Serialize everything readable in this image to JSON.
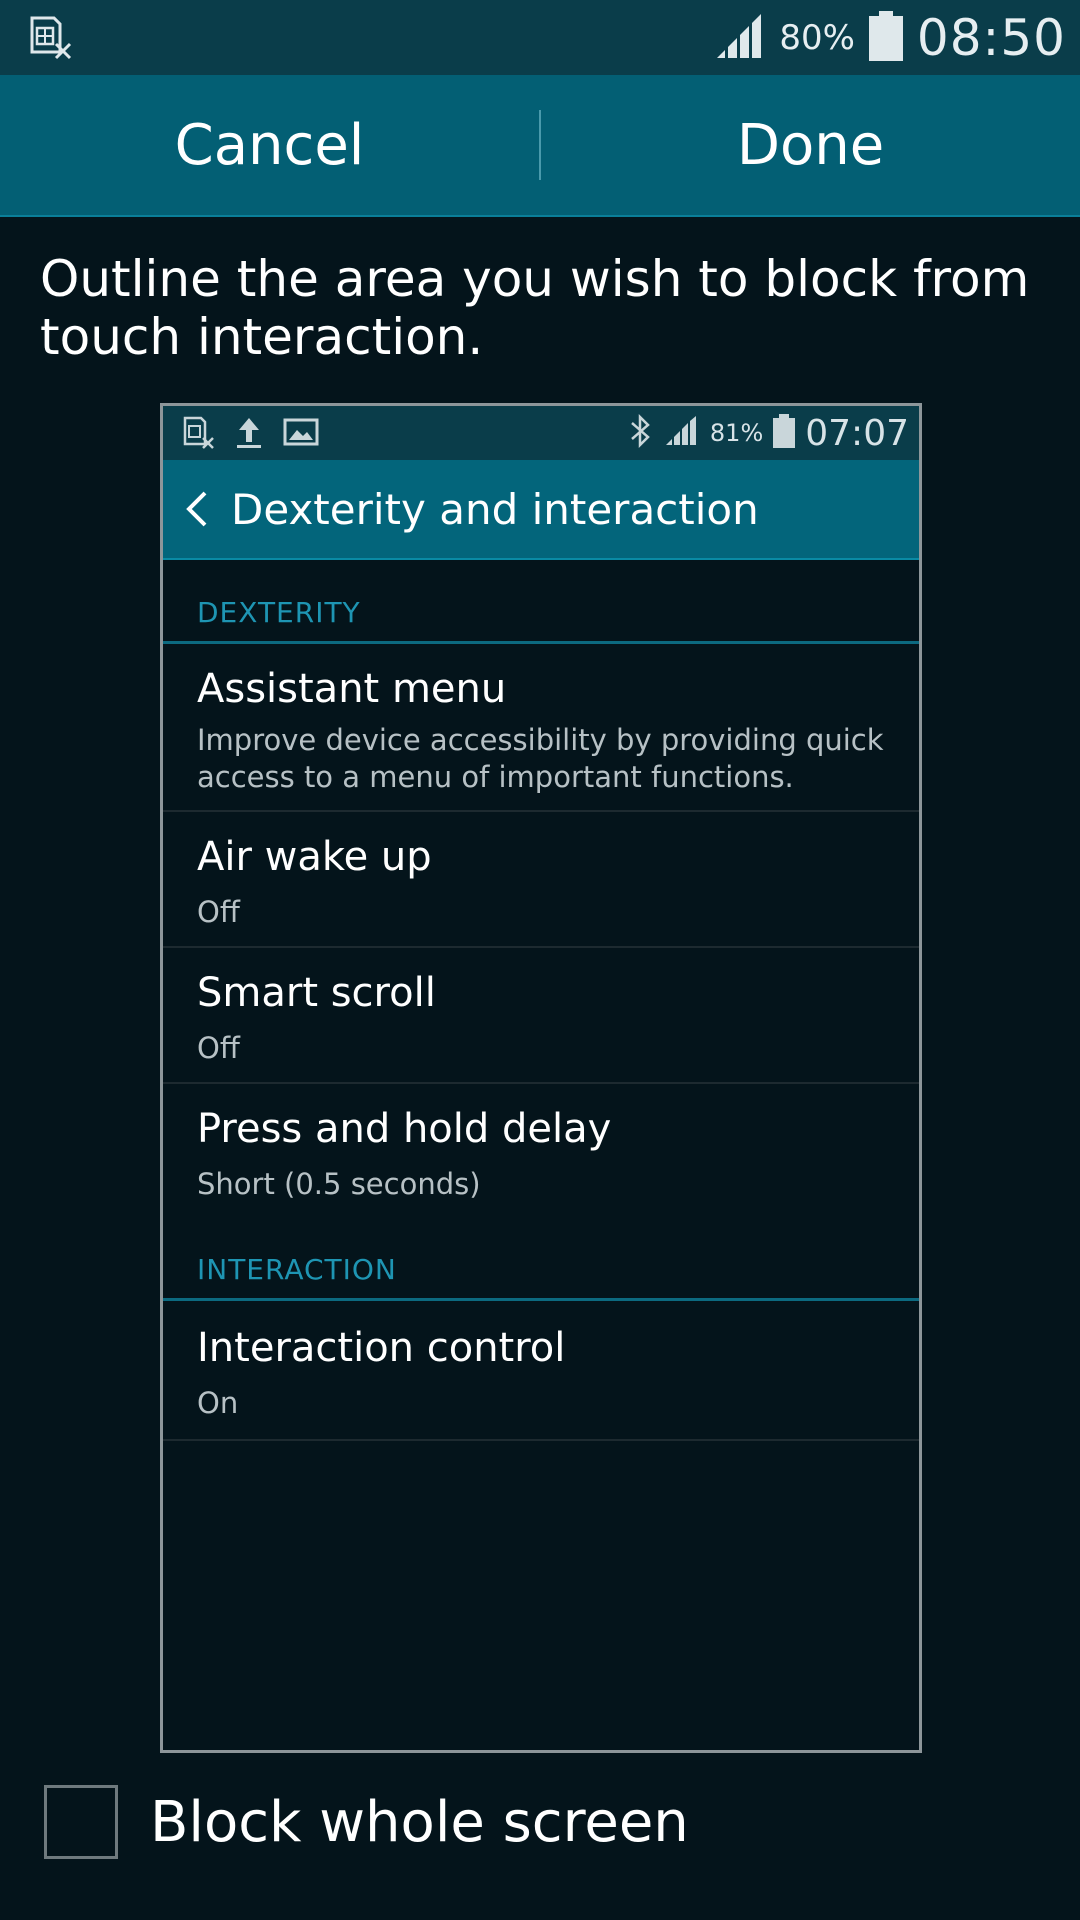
{
  "status_bar": {
    "battery_percent": "80%",
    "time": "08:50"
  },
  "action_bar": {
    "cancel_label": "Cancel",
    "done_label": "Done"
  },
  "instruction": "Outline the area you wish to block from touch interaction.",
  "preview": {
    "status_bar": {
      "battery_percent": "81%",
      "time": "07:07"
    },
    "title": "Dexterity and interaction",
    "sections": [
      {
        "label": "DEXTERITY",
        "items": [
          {
            "title": "Assistant menu",
            "subtitle": "Improve device accessibility by providing quick access to a menu of important functions."
          },
          {
            "title": "Air wake up",
            "subtitle": "Off"
          },
          {
            "title": "Smart scroll",
            "subtitle": "Off"
          },
          {
            "title": "Press and hold delay",
            "subtitle": "Short (0.5 seconds)"
          }
        ]
      },
      {
        "label": "INTERACTION",
        "items": [
          {
            "title": "Interaction control",
            "subtitle": "On"
          }
        ]
      }
    ]
  },
  "block_whole_screen": {
    "label": "Block whole screen",
    "checked": false
  },
  "colors": {
    "status_bar": "#0a3d4a",
    "action_bar": "#035f74",
    "background": "#04141b",
    "section_accent": "#1e95b3"
  }
}
